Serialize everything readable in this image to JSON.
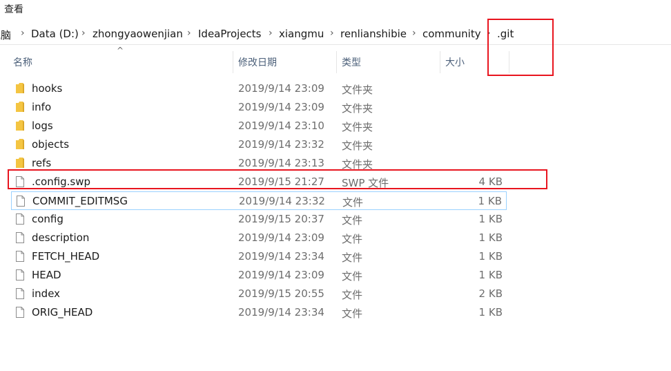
{
  "ribbon": {
    "tab_view": "查看"
  },
  "breadcrumb": {
    "items": [
      "电脑",
      "Data (D:)",
      "zhongyaowenjian",
      "IdeaProjects",
      "xiangmu",
      "renlianshibie",
      "community",
      ".git"
    ],
    "separator": "›"
  },
  "columns": {
    "name": "名称",
    "modified": "修改日期",
    "type": "类型",
    "size": "大小",
    "sort_indicator": "^"
  },
  "files": [
    {
      "name": "hooks",
      "modified": "2019/9/14 23:09",
      "type": "文件夹",
      "size": "",
      "icon": "folder-icon"
    },
    {
      "name": "info",
      "modified": "2019/9/14 23:09",
      "type": "文件夹",
      "size": "",
      "icon": "folder-icon"
    },
    {
      "name": "logs",
      "modified": "2019/9/14 23:10",
      "type": "文件夹",
      "size": "",
      "icon": "folder-icon"
    },
    {
      "name": "objects",
      "modified": "2019/9/14 23:32",
      "type": "文件夹",
      "size": "",
      "icon": "folder-icon"
    },
    {
      "name": "refs",
      "modified": "2019/9/14 23:13",
      "type": "文件夹",
      "size": "",
      "icon": "folder-icon"
    },
    {
      "name": ".config.swp",
      "modified": "2019/9/15 21:27",
      "type": "SWP 文件",
      "size": "4 KB",
      "icon": "file-icon"
    },
    {
      "name": "COMMIT_EDITMSG",
      "modified": "2019/9/14 23:32",
      "type": "文件",
      "size": "1 KB",
      "icon": "file-icon"
    },
    {
      "name": "config",
      "modified": "2019/9/15 20:37",
      "type": "文件",
      "size": "1 KB",
      "icon": "file-icon"
    },
    {
      "name": "description",
      "modified": "2019/9/14 23:09",
      "type": "文件",
      "size": "1 KB",
      "icon": "file-icon"
    },
    {
      "name": "FETCH_HEAD",
      "modified": "2019/9/14 23:34",
      "type": "文件",
      "size": "1 KB",
      "icon": "file-icon"
    },
    {
      "name": "HEAD",
      "modified": "2019/9/14 23:09",
      "type": "文件",
      "size": "1 KB",
      "icon": "file-icon"
    },
    {
      "name": "index",
      "modified": "2019/9/15 20:55",
      "type": "文件",
      "size": "2 KB",
      "icon": "file-icon"
    },
    {
      "name": "ORIG_HEAD",
      "modified": "2019/9/14 23:34",
      "type": "文件",
      "size": "1 KB",
      "icon": "file-icon"
    }
  ],
  "colors": {
    "annotation": "#e8141e",
    "focus_border": "#99d1ff",
    "folder": "#f4c542",
    "header_text": "#4c607a"
  }
}
